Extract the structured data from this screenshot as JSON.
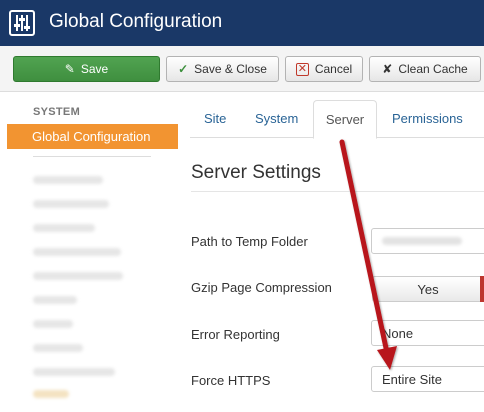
{
  "header": {
    "title": "Global Configuration",
    "icon": "sliders-icon"
  },
  "toolbar": {
    "save_label": "Save",
    "save_close_label": "Save & Close",
    "cancel_label": "Cancel",
    "clean_cache_label": "Clean Cache"
  },
  "sidebar": {
    "heading": "SYSTEM",
    "active_item": "Global Configuration"
  },
  "tabs": {
    "site": "Site",
    "system": "System",
    "server": "Server",
    "permissions": "Permissions",
    "active": "Server"
  },
  "main": {
    "section_title": "Server Settings",
    "rows": {
      "temp_folder_label": "Path to Temp Folder",
      "gzip_label": "Gzip Page Compression",
      "gzip_value": "Yes",
      "error_reporting_label": "Error Reporting",
      "error_reporting_value": "None",
      "force_https_label": "Force HTTPS",
      "force_https_value": "Entire Site"
    }
  },
  "colors": {
    "header_bg": "#1a3867",
    "save_green": "#46a046",
    "active_orange": "#f29431",
    "arrow_red": "#b8141a",
    "link_blue": "#2a6496"
  }
}
